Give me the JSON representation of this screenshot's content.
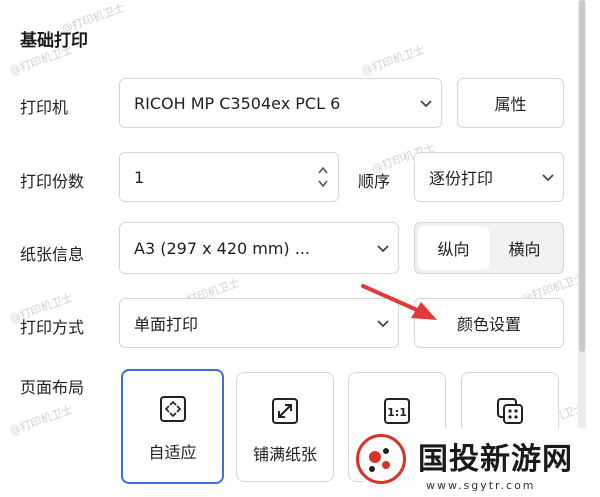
{
  "section": {
    "title": "基础打印"
  },
  "printer": {
    "label": "打印机",
    "value": "RICOH MP C3504ex PCL 6",
    "properties_button": "属性"
  },
  "copies": {
    "label": "打印份数",
    "value": "1",
    "order_label": "顺序",
    "order_value": "逐份打印"
  },
  "paper": {
    "label": "纸张信息",
    "value": "A3 (297 x 420 mm) ...",
    "orientation": [
      "纵向",
      "横向"
    ],
    "active_orientation": "纵向"
  },
  "mode": {
    "label": "打印方式",
    "value": "单面打印",
    "color_settings_button": "颜色设置"
  },
  "layout": {
    "label": "页面布局",
    "options": [
      {
        "label": "自适应",
        "icon": "fit-icon",
        "selected": true
      },
      {
        "label": "铺满纸张",
        "icon": "expand-icon",
        "selected": false
      },
      {
        "label": "",
        "icon": "actual-size-icon",
        "selected": false
      },
      {
        "label": "",
        "icon": "multi-page-icon",
        "selected": false
      }
    ]
  },
  "watermark": {
    "text": "@打印机卫士"
  },
  "logo": {
    "text": "国投新游网",
    "url": "www.sgytr.com"
  },
  "colors": {
    "accent": "#3b6fe0",
    "arrow": "#e0393a",
    "border": "#d6d6d6",
    "logo_red": "#d4342a"
  }
}
